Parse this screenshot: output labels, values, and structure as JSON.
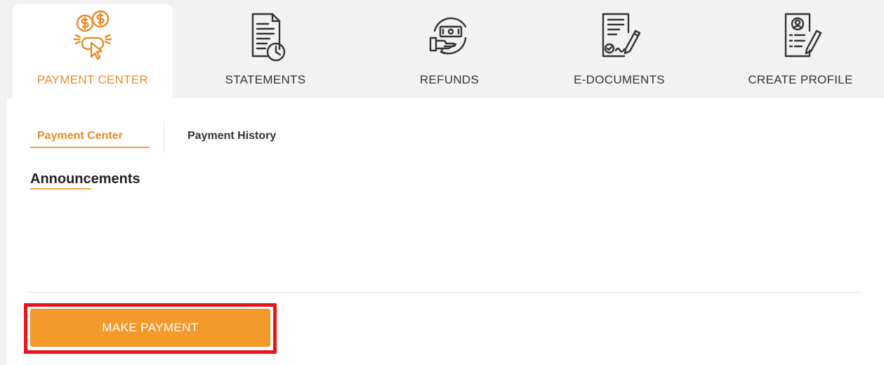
{
  "tabs": [
    {
      "label": "PAYMENT CENTER",
      "icon": "payment-click-icon",
      "active": true
    },
    {
      "label": "STATEMENTS",
      "icon": "statement-clock-icon",
      "active": false
    },
    {
      "label": "REFUNDS",
      "icon": "refund-cash-icon",
      "active": false
    },
    {
      "label": "E-DOCUMENTS",
      "icon": "signed-document-icon",
      "active": false
    },
    {
      "label": "CREATE PROFILE",
      "icon": "profile-document-icon",
      "active": false
    }
  ],
  "subtabs": [
    {
      "label": "Payment Center",
      "active": true
    },
    {
      "label": "Payment History",
      "active": false
    }
  ],
  "announcements": {
    "title": "Announcements"
  },
  "actions": {
    "make_payment_label": "MAKE PAYMENT"
  },
  "colors": {
    "accent": "#e88b2a",
    "button": "#f39a2b",
    "highlight_border": "#e8141c",
    "tab_bar_bg": "#f2f2f2"
  }
}
